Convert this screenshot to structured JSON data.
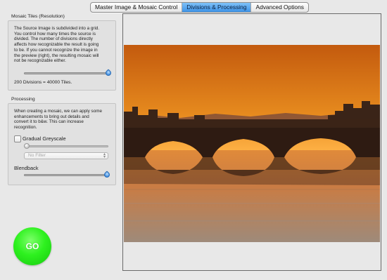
{
  "tabs": [
    {
      "label": "Master Image & Mosaic Control",
      "active": false
    },
    {
      "label": "Divisions & Processing",
      "active": true
    },
    {
      "label": "Advanced Options",
      "active": false
    }
  ],
  "mosaic_tiles": {
    "title": "Mosaic Tiles (Resolution)",
    "description": [
      "The Source Image is subdivided into a grid.",
      "You control how many times the source is",
      "divided. The number of divisions directly",
      "affects how recognizable the result is going",
      "to be.  If you cannot recognize the image in",
      "the preview (right), the resulting mosaic will",
      "not be recognizable either."
    ],
    "slider_level": 1.0,
    "status": "200 Divisions = 40000 Tiles."
  },
  "processing": {
    "title": "Processing",
    "description": [
      "When creating a mosaic, we can apply  some",
      "enhancements to bring out details and",
      "convert it to b&w. This can increase",
      "recognition."
    ],
    "greyscale_label": "Gradual Greyscale",
    "greyscale_checked": false,
    "greyscale_level": 0.0,
    "filter_selected": "No Filter",
    "blendback_label": "Blendback",
    "blendback_level": 1.0
  },
  "go_button": {
    "label": "GO"
  },
  "colors": {
    "tab_active": "#3d92e6",
    "go_green": "#2ef11f",
    "slider_knob": "#3a8be0",
    "sky_top": "#c35a0e",
    "sky_glow": "#ffb347"
  },
  "icons": {
    "popup_arrows": "up-down-arrows-icon"
  }
}
